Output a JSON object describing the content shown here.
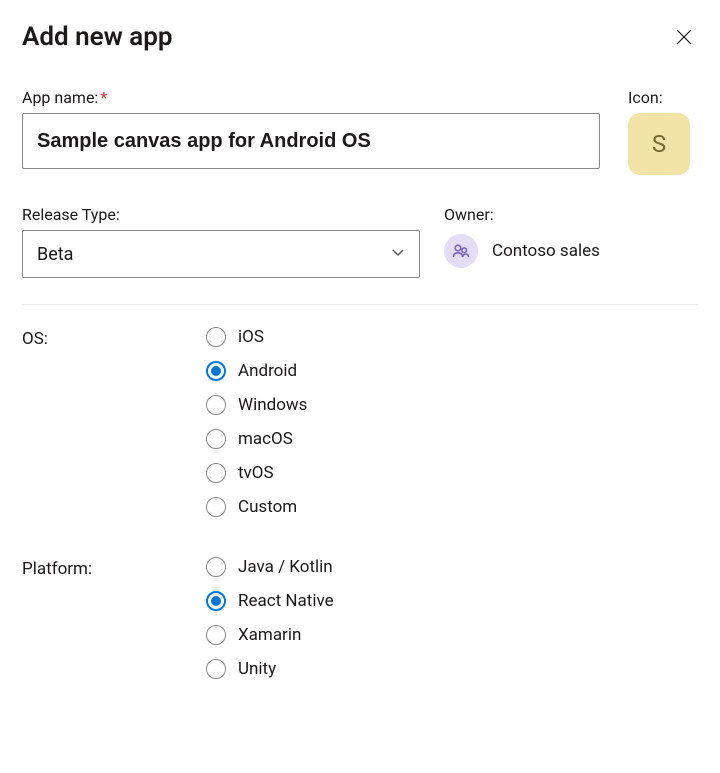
{
  "dialog": {
    "title": "Add new app"
  },
  "form": {
    "app_name_label": "App name:",
    "app_name_value": "Sample canvas app for Android OS",
    "icon_label": "Icon:",
    "icon_letter": "S",
    "release_type_label": "Release Type:",
    "release_type_value": "Beta",
    "owner_label": "Owner:",
    "owner_name": "Contoso sales"
  },
  "os": {
    "label": "OS:",
    "selected": "Android",
    "options": [
      "iOS",
      "Android",
      "Windows",
      "macOS",
      "tvOS",
      "Custom"
    ]
  },
  "platform": {
    "label": "Platform:",
    "selected": "React Native",
    "options": [
      "Java / Kotlin",
      "React Native",
      "Xamarin",
      "Unity"
    ]
  }
}
